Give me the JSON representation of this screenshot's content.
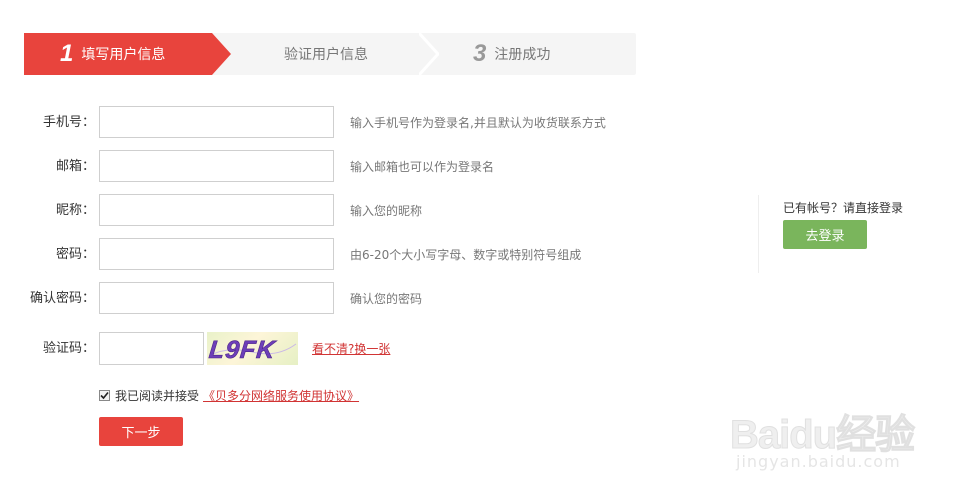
{
  "steps": [
    {
      "num": "1",
      "label": "填写用户信息",
      "active": true
    },
    {
      "num": "",
      "label": "验证用户信息",
      "active": false
    },
    {
      "num": "3",
      "label": "注册成功",
      "active": false
    }
  ],
  "form": {
    "phone": {
      "label": "手机号：",
      "value": "",
      "hint": "输入手机号作为登录名,并且默认为收货联系方式"
    },
    "email": {
      "label": "邮箱：",
      "value": "",
      "hint": "输入邮箱也可以作为登录名"
    },
    "nickname": {
      "label": "昵称：",
      "value": "",
      "hint": "输入您的昵称"
    },
    "password": {
      "label": "密码：",
      "value": "",
      "hint": "由6-20个大小写字母、数字或特别符号组成"
    },
    "confirm_password": {
      "label": "确认密码：",
      "value": "",
      "hint": "确认您的密码"
    },
    "captcha": {
      "label": "验证码：",
      "value": "",
      "image_text": "L9FK",
      "refresh_link": "看不清?换一张"
    }
  },
  "agreement": {
    "checked": true,
    "text": "我已阅读并接受",
    "link": "《贝多分网络服务使用协议》"
  },
  "next_button": "下一步",
  "side": {
    "text": "已有帐号？请直接登录",
    "login_button": "去登录"
  },
  "watermark": {
    "brand": "Baidu经验",
    "url": "jingyan.baidu.com"
  },
  "colors": {
    "accent": "#e8443d",
    "login_green": "#7ab55c",
    "link_red": "#d13434"
  }
}
